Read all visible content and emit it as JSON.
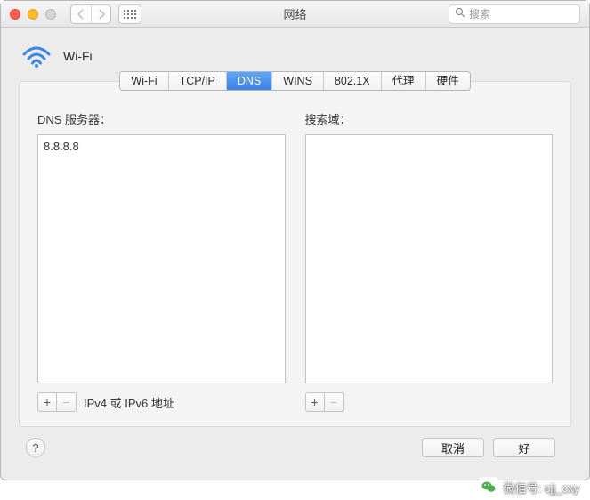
{
  "window": {
    "title": "网络"
  },
  "search": {
    "placeholder": "搜索"
  },
  "interface": {
    "label": "Wi-Fi"
  },
  "tabs": {
    "items": [
      {
        "label": "Wi-Fi"
      },
      {
        "label": "TCP/IP"
      },
      {
        "label": "DNS"
      },
      {
        "label": "WINS"
      },
      {
        "label": "802.1X"
      },
      {
        "label": "代理"
      },
      {
        "label": "硬件"
      }
    ],
    "active_index": 2
  },
  "dns": {
    "label": "DNS 服务器：",
    "entries": [
      "8.8.8.8"
    ],
    "hint": "IPv4 或 IPv6 地址"
  },
  "search_domains": {
    "label": "搜索域：",
    "entries": []
  },
  "buttons": {
    "cancel": "取消",
    "ok": "好",
    "help": "?"
  },
  "watermark": {
    "text": "微信号: cjj_cxy"
  }
}
